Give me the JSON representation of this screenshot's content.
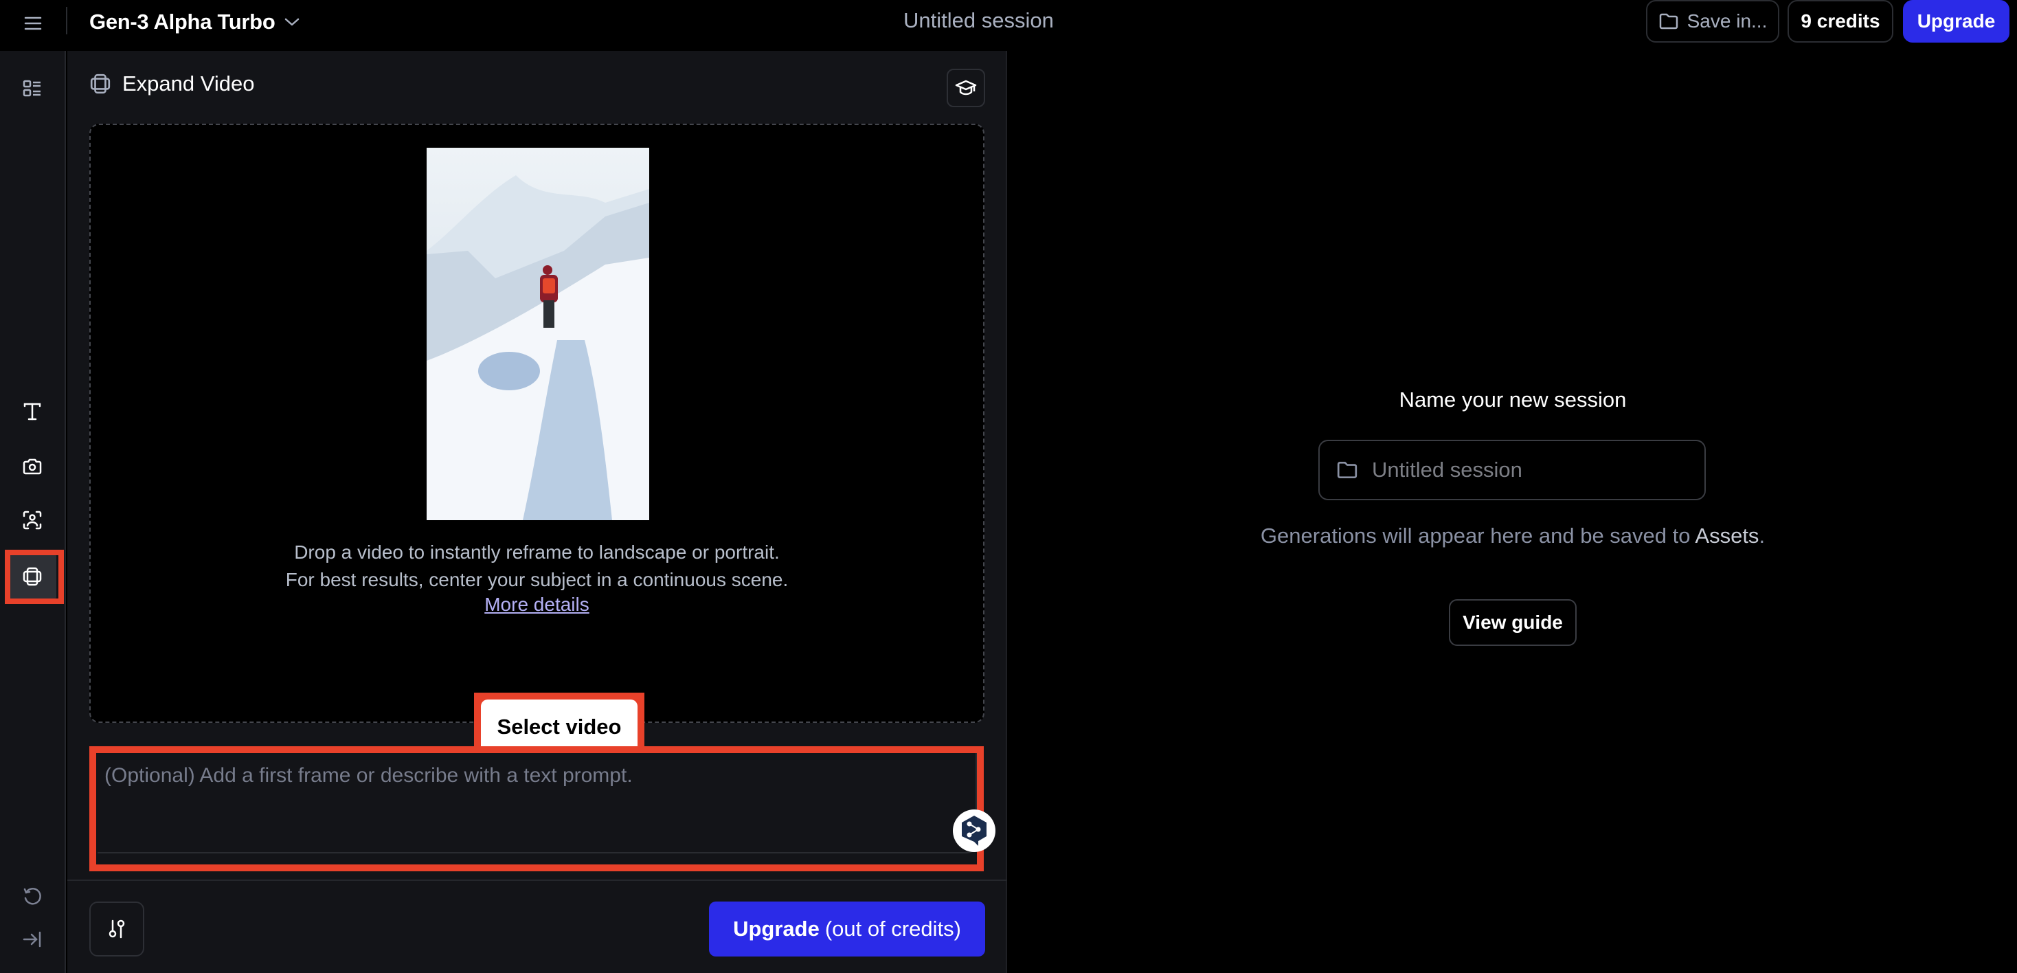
{
  "header": {
    "model_name": "Gen-3 Alpha Turbo",
    "session_title": "Untitled session",
    "save_label": "Save in...",
    "credits_label": "9 credits",
    "upgrade_label": "Upgrade"
  },
  "sidebar": {
    "items": [
      {
        "name": "sessions-list",
        "icon": "list-grid-icon"
      },
      {
        "name": "text-tool",
        "icon": "text-icon"
      },
      {
        "name": "image-tool",
        "icon": "camera-icon"
      },
      {
        "name": "act-one-tool",
        "icon": "person-focus-icon"
      },
      {
        "name": "expand-video-tool",
        "icon": "expand-frame-icon",
        "active": true
      }
    ],
    "bottom_items": [
      {
        "name": "history",
        "icon": "history-icon"
      },
      {
        "name": "collapse",
        "icon": "collapse-right-icon"
      }
    ]
  },
  "panel": {
    "title": "Expand Video",
    "drop_line1": "Drop a video to instantly reframe to landscape or portrait.",
    "drop_line2": "For best results, center your subject in a continuous scene.",
    "more_details": "More details",
    "select_video": "Select video",
    "thumbnail_alt": "Hiker walking along a snowy mountain ridge",
    "prompt_placeholder": "(Optional) Add a first frame or describe with a text prompt.",
    "upgrade_bold": "Upgrade",
    "upgrade_suffix": "(out of credits)"
  },
  "right": {
    "name_title": "Name your new session",
    "session_placeholder": "Untitled session",
    "gen_text_prefix": "Generations will appear here and be saved to ",
    "gen_text_assets": "Assets",
    "gen_text_suffix": ".",
    "view_guide": "View guide"
  },
  "colors": {
    "accent": "#2b2be8",
    "highlight": "#e8412a",
    "link": "#b4b0f5"
  }
}
